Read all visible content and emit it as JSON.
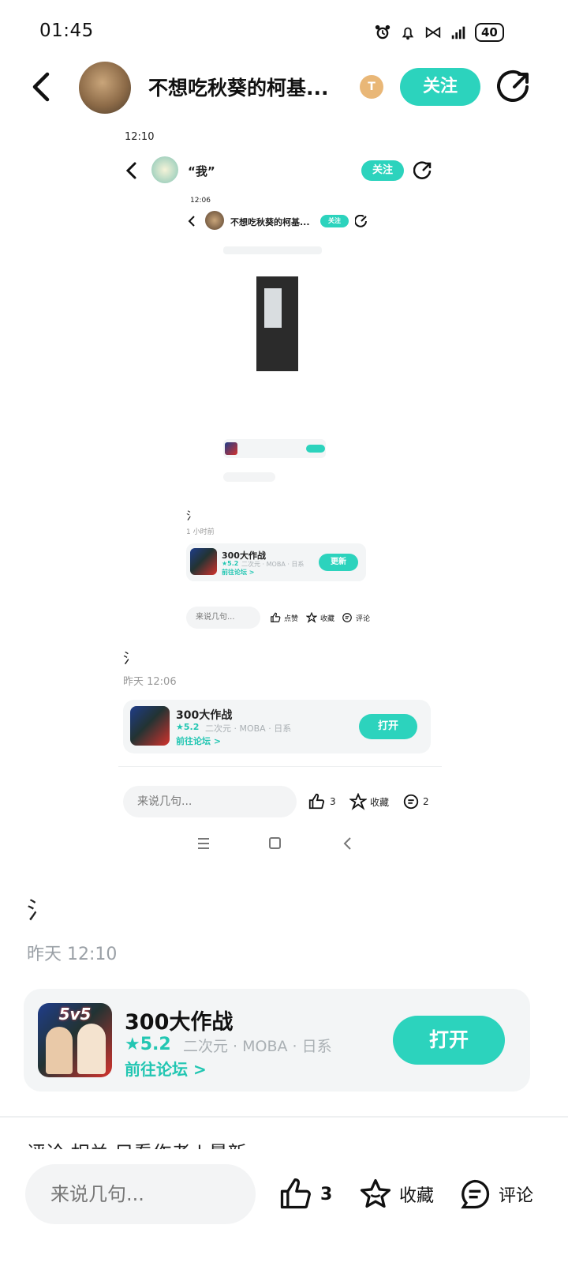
{
  "status_bar": {
    "time": "01:45",
    "battery": "40"
  },
  "header": {
    "title": "不想吃秋葵的柯基...",
    "level": "T",
    "follow_label": "关注"
  },
  "embed1": {
    "time": "12:10",
    "title": "“我”",
    "follow_label": "关注",
    "glyph": "氵",
    "date": "昨天 12:06",
    "app": {
      "name": "300大作战",
      "rating": "★5.2",
      "meta": "二次元 · MOBA · 日系",
      "forum": "前往论坛 >",
      "button": "打开"
    },
    "input_placeholder": "来说几句...",
    "like_count": "3",
    "collect_label": "收藏",
    "comment_count": "2"
  },
  "embed2": {
    "time": "12:06",
    "title": "不想吃秋葵的柯基...",
    "follow_label": "关注",
    "glyph": "氵",
    "date": "1 小时前",
    "app": {
      "name": "300大作战",
      "rating": "★5.2",
      "meta": "二次元 · MOBA · 日系",
      "forum": "前往论坛 >",
      "button": "更新"
    },
    "input_placeholder": "来说几句...",
    "like_label": "点赞",
    "collect_label": "收藏",
    "comment_label": "评论"
  },
  "main": {
    "glyph": "氵",
    "date": "昨天 12:10",
    "app": {
      "name": "300大作战",
      "rating": "★5.2",
      "meta": "二次元 · MOBA · 日系",
      "forum": "前往论坛 >",
      "button": "打开",
      "icon_tag": "5v5"
    },
    "tabs_peek": "评论    相关                                    只看作者  |  最新"
  },
  "bottom_bar": {
    "input_placeholder": "来说几句...",
    "like_count": "3",
    "collect_label": "收藏",
    "comment_label": "评论"
  },
  "colors": {
    "accent": "#2cd3bd",
    "card_bg": "#f3f5f6",
    "meta_gray": "#aab0b4"
  }
}
